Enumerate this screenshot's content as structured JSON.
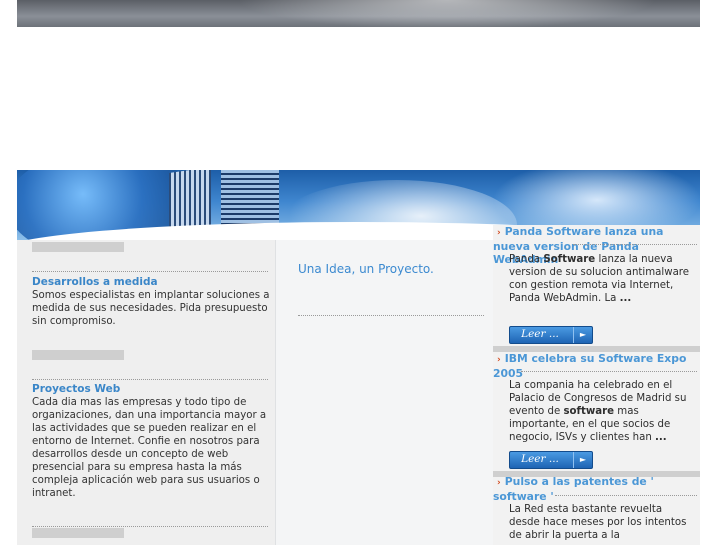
{
  "left": {
    "sections": [
      {
        "title": "Desarrollos a medida",
        "text": "Somos especialistas en implantar soluciones a medida de sus necesidades. Pida presupuesto sin compromiso."
      },
      {
        "title": "Proyectos Web",
        "text": "Cada dia mas las empresas y todo tipo de organizaciones, dan una importancia mayor a las actividades que se pueden realizar en el entorno de Internet. Confie en nosotros para desarrollos desde un concepto de web presencial para su empresa hasta la más compleja aplicación web para sus usuarios o intranet."
      }
    ]
  },
  "middle": {
    "slogan": "Una Idea, un Proyecto."
  },
  "news": {
    "bullet_icon": "›",
    "read_more_label": "Leer ...",
    "items": [
      {
        "title": "Panda Software lanza una nueva version de Panda WebAdmin",
        "pre": "Panda ",
        "bold": "Software",
        "post": " lanza la nueva version de su solucion antimalware con gestion remota via Internet, Panda WebAdmin. La ",
        "ellipsis": "..."
      },
      {
        "title": "IBM celebra su Software Expo 2005",
        "pre": "La compania ha celebrado en el Palacio de Congresos de Madrid su evento de ",
        "bold": "software",
        "post": " mas importante, en el que socios de negocio, ISVs y clientes han ",
        "ellipsis": "..."
      },
      {
        "title": "Pulso a las patentes de ' software '",
        "pre": "La Red esta bastante revuelta desde hace meses por los intentos de abrir la puerta a la",
        "bold": "",
        "post": "",
        "ellipsis": ""
      }
    ]
  },
  "colors": {
    "link_blue": "#3a86c8",
    "bullet_red": "#d24a1f",
    "button_blue": "#1e64b4"
  }
}
